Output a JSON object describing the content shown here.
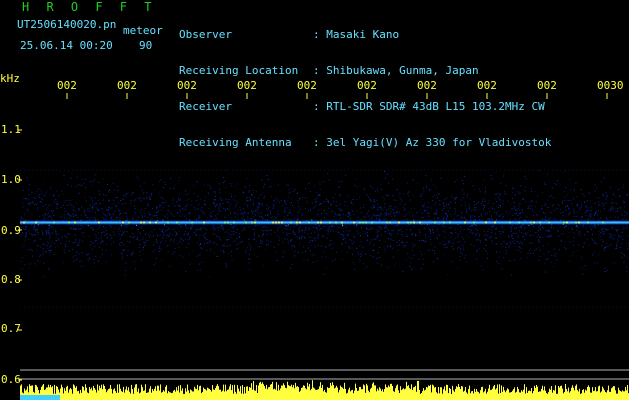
{
  "header": {
    "app_title": "H R O F F T",
    "file_name": "UT2506140020.pn",
    "meteor_tag": "meteor",
    "datetime": "25.06.14 00:20",
    "count": "90"
  },
  "info": {
    "labels": [
      "Observer",
      "Receiving Location",
      "Receiver",
      "Receiving Antenna"
    ],
    "values": [
      ": Masaki Kano",
      ": Shibukawa, Gunma, Japan",
      ": RTL-SDR SDR# 43dB L15 103.2MHz CW",
      ": 3el Yagi(V) Az 330 for Vladivostok"
    ]
  },
  "axes": {
    "y_unit": "kHz",
    "y_ticks": [
      "1.1",
      "1.0",
      "0.9",
      "0.8",
      "0.7",
      "0.6"
    ],
    "x_ticks": [
      "002",
      "002",
      "002",
      "002",
      "002",
      "002",
      "002",
      "002",
      "002",
      "0030"
    ]
  },
  "colors": {
    "background": "#000000",
    "title": "#22cc22",
    "header_text": "#66e0ff",
    "tick_text": "#ffff40",
    "signal_low": "#1030c0",
    "signal_mid": "#40d0ff",
    "signal_high": "#ffff40",
    "grid_line": "#b0b0b0"
  },
  "spectrum": {
    "carrier_khz": 0.915,
    "band_top_khz": 1.01,
    "band_bottom_khz": 0.79,
    "level_meter": "strong"
  }
}
